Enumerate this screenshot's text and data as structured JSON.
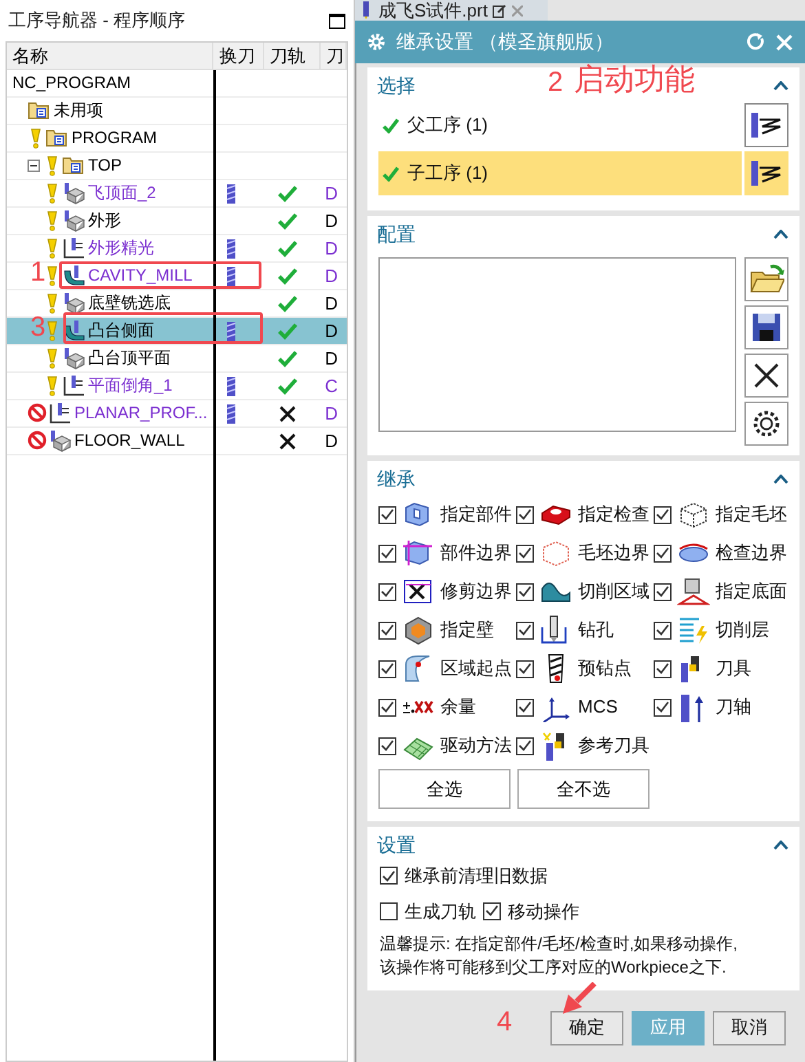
{
  "navigator": {
    "title": "工序导航器 - 程序顺序",
    "columns": [
      "名称",
      "换刀",
      "刀轨",
      "刀"
    ],
    "tree": [
      {
        "name": "NC_PROGRAM",
        "color": "#000000",
        "selected": false,
        "children": [
          {
            "name": "未用项",
            "kind": "folder",
            "color": "#000000",
            "selected": false
          },
          {
            "name": "PROGRAM",
            "kind": "folder",
            "blocked": false,
            "color": "#000000",
            "selected": false
          },
          {
            "name": "TOP",
            "kind": "folder",
            "blocked": false,
            "color": "#000000",
            "selected": false,
            "expanded": true,
            "children": [
              {
                "name": "飞顶面_2",
                "kind": "mill",
                "blocked": false,
                "color": "#7b2fd0",
                "tool_change": true,
                "toolpath_ok": true,
                "column_4": "D",
                "selected": false
              },
              {
                "name": "外形",
                "kind": "mill",
                "blocked": false,
                "color": "#000000",
                "toolpath_ok": true,
                "column_4": "D",
                "selected": false
              },
              {
                "name": "外形精光",
                "kind": "planar",
                "blocked": false,
                "color": "#7b2fd0",
                "tool_change": true,
                "toolpath_ok": true,
                "column_4": "D",
                "selected": false
              },
              {
                "name": "CAVITY_MILL",
                "kind": "cavity",
                "blocked": false,
                "color": "#7b2fd0",
                "tool_change": true,
                "toolpath_ok": true,
                "column_4": "D",
                "selected": false
              },
              {
                "name": "底壁铣选底",
                "kind": "mill",
                "blocked": false,
                "color": "#000000",
                "toolpath_ok": true,
                "column_4": "D",
                "selected": false
              },
              {
                "name": "凸台侧面",
                "kind": "cavity",
                "blocked": false,
                "color": "#000000",
                "tool_change": true,
                "toolpath_ok": true,
                "column_4": "D",
                "selected": true
              },
              {
                "name": "凸台顶平面",
                "kind": "mill",
                "blocked": false,
                "color": "#000000",
                "toolpath_ok": true,
                "column_4": "D",
                "selected": false
              },
              {
                "name": "平面倒角_1",
                "kind": "planar",
                "blocked": false,
                "color": "#7b2fd0",
                "tool_change": true,
                "toolpath_ok": true,
                "column_4": "C",
                "selected": false
              }
            ]
          },
          {
            "name": "PLANAR_PROF...",
            "kind": "planar",
            "blocked": true,
            "color": "#7b2fd0",
            "tool_change": true,
            "toolpath_ok": false,
            "column_4": "D",
            "selected": false
          },
          {
            "name": "FLOOR_WALL",
            "kind": "mill",
            "blocked": true,
            "color": "#000000",
            "toolpath_ok": false,
            "column_4": "D",
            "selected": false
          }
        ]
      }
    ]
  },
  "file_tab": {
    "title": "成飞S试件.prt"
  },
  "dialog": {
    "title": "继承设置 （模圣旗舰版）",
    "selection": {
      "title": "选择",
      "expanded": true,
      "items": [
        {
          "label": "父工序 (1)",
          "selected": false
        },
        {
          "label": "子工序 (1)",
          "selected": true
        }
      ]
    },
    "config": {
      "title": "配置",
      "expanded": true
    },
    "inherit": {
      "title": "继承",
      "expanded": true,
      "items": [
        {
          "label": "指定部件",
          "checked": true
        },
        {
          "label": "指定检查",
          "checked": true
        },
        {
          "label": "指定毛坯",
          "checked": true
        },
        {
          "label": "部件边界",
          "checked": true
        },
        {
          "label": "毛坯边界",
          "checked": true
        },
        {
          "label": "检查边界",
          "checked": true
        },
        {
          "label": "修剪边界",
          "checked": true
        },
        {
          "label": "切削区域",
          "checked": true
        },
        {
          "label": "指定底面",
          "checked": true
        },
        {
          "label": "指定壁",
          "checked": true
        },
        {
          "label": "钻孔",
          "checked": true
        },
        {
          "label": "切削层",
          "checked": true
        },
        {
          "label": "区域起点",
          "checked": true
        },
        {
          "label": "预钻点",
          "checked": true
        },
        {
          "label": "刀具",
          "checked": true
        },
        {
          "label": "余量",
          "checked": true
        },
        {
          "label": "MCS",
          "checked": true
        },
        {
          "label": "刀轴",
          "checked": true
        },
        {
          "label": "驱动方法",
          "checked": true
        },
        {
          "label": "参考刀具",
          "checked": true
        }
      ],
      "buttons": [
        "全选",
        "全不选"
      ]
    },
    "settings": {
      "title": "设置",
      "expanded": true,
      "options": [
        {
          "label": "继承前清理旧数据",
          "checked": true
        },
        {
          "label": "生成刀轨",
          "checked": false
        },
        {
          "label": "移动操作",
          "checked": true
        }
      ],
      "hint_lines": [
        "温馨提示: 在指定部件/毛坯/检查时,如果移动操作,",
        "该操作将可能移到父工序对应的Workpiece之下."
      ]
    },
    "buttons": [
      {
        "label": "确定",
        "kind": "default"
      },
      {
        "label": "应用",
        "kind": "primary"
      },
      {
        "label": "取消",
        "kind": "default"
      }
    ]
  },
  "annotations": {
    "step_1": "1",
    "step_2": "2",
    "step_2_note": "启动功能",
    "step_3": "3",
    "step_4": "4"
  }
}
